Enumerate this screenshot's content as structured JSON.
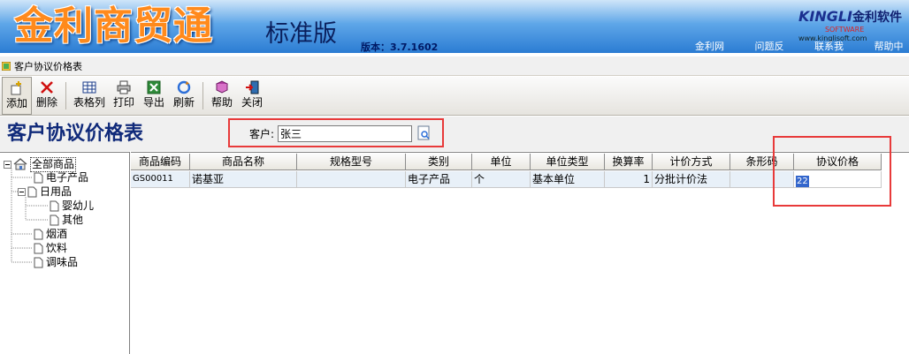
{
  "banner": {
    "app_name": "金利商贸通",
    "edition": "标准版",
    "version": "版本：3.7.1602",
    "logo_text": "KINGLI",
    "logo_cn": "金利软件",
    "logo_sub": "SOFTWARE",
    "logo_url": "www.kinglisoft.com",
    "links": [
      "金利网站",
      "问题反馈",
      "联系我们",
      "帮助中心"
    ]
  },
  "window": {
    "title": "客户协议价格表"
  },
  "toolbar": {
    "add": "添加",
    "delete": "删除",
    "table_columns": "表格列",
    "print": "打印",
    "export": "导出",
    "refresh": "刷新",
    "help": "帮助",
    "close": "关闭"
  },
  "header": {
    "page_title": "客户协议价格表",
    "customer_label": "客户:",
    "customer_value": "张三"
  },
  "tree": {
    "root": "全部商品",
    "items": [
      "电子产品",
      "日用品",
      "婴幼儿",
      "其他",
      "烟酒",
      "饮料",
      "调味品"
    ]
  },
  "grid": {
    "columns": [
      "商品编码",
      "商品名称",
      "规格型号",
      "类别",
      "单位",
      "单位类型",
      "换算率",
      "计价方式",
      "条形码",
      "协议价格"
    ],
    "rows": [
      [
        "GS00011",
        "诺基亚",
        "",
        "电子产品",
        "个",
        "基本单位",
        "1",
        "分批计价法",
        "",
        "22"
      ]
    ]
  },
  "colors": {
    "highlight": "#e83a3a",
    "title": "#102a7a",
    "banner_orange": "#ff8a1c"
  }
}
